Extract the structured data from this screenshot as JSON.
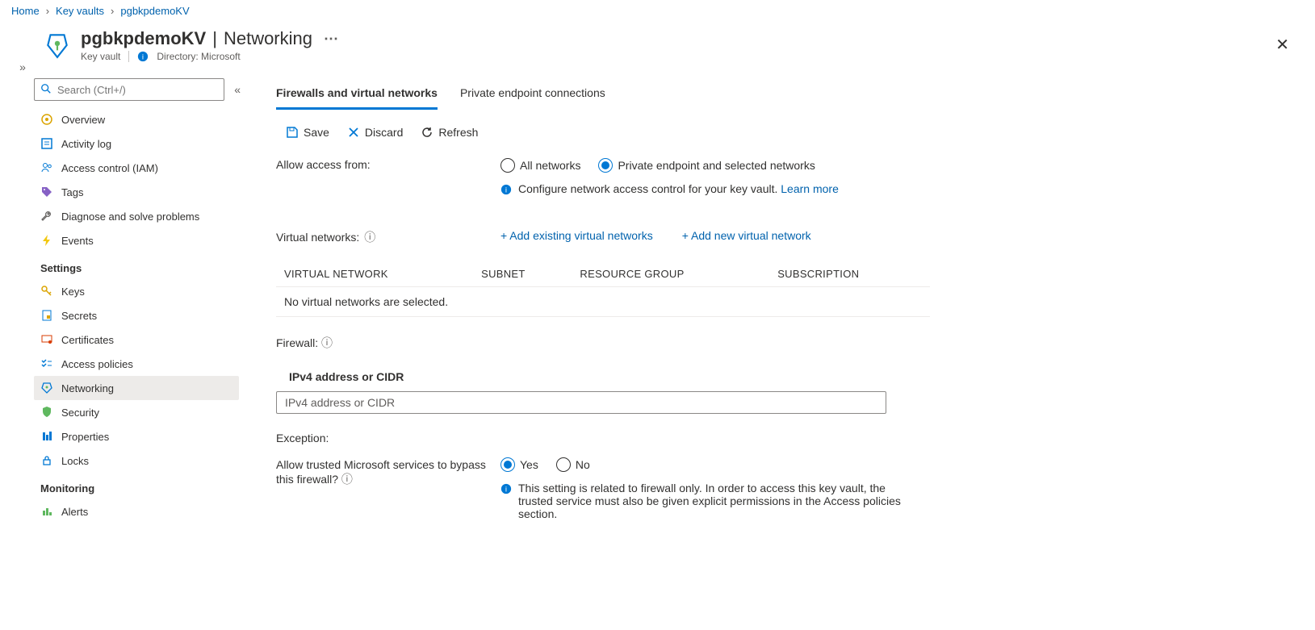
{
  "breadcrumb": {
    "home": "Home",
    "level1": "Key vaults",
    "level2": "pgbkpdemoKV"
  },
  "header": {
    "title": "pgbkpdemoKV",
    "section": "Networking",
    "subtitle": "Key vault",
    "directory": "Directory: Microsoft"
  },
  "search": {
    "placeholder": "Search (Ctrl+/)"
  },
  "nav": {
    "overview": "Overview",
    "activity": "Activity log",
    "iam": "Access control (IAM)",
    "tags": "Tags",
    "diag": "Diagnose and solve problems",
    "events": "Events",
    "settings_heading": "Settings",
    "keys": "Keys",
    "secrets": "Secrets",
    "certs": "Certificates",
    "access": "Access policies",
    "networking": "Networking",
    "security": "Security",
    "properties": "Properties",
    "locks": "Locks",
    "monitoring_heading": "Monitoring",
    "alerts": "Alerts"
  },
  "tabs": {
    "firewalls": "Firewalls and virtual networks",
    "pe": "Private endpoint connections"
  },
  "toolbar": {
    "save": "Save",
    "discard": "Discard",
    "refresh": "Refresh"
  },
  "allow": {
    "label": "Allow access from:",
    "all": "All networks",
    "selected": "Private endpoint and selected networks",
    "hint": "Configure network access control for your key vault.",
    "learn": "Learn more"
  },
  "vnet": {
    "label": "Virtual networks:",
    "add_existing": "+ Add existing virtual networks",
    "add_new": "+ Add new virtual network",
    "col_vnet": "Virtual Network",
    "col_subnet": "Subnet",
    "col_rg": "Resource Group",
    "col_sub": "Subscription",
    "empty": "No virtual networks are selected."
  },
  "firewall": {
    "label": "Firewall:",
    "cidr_heading": "IPv4 address or CIDR",
    "cidr_placeholder": "IPv4 address or CIDR"
  },
  "exception": {
    "heading": "Exception:",
    "question": "Allow trusted Microsoft services to bypass this firewall?",
    "yes": "Yes",
    "no": "No",
    "note": "This setting is related to firewall only. In order to access this key vault, the trusted service must also be given explicit permissions in the Access policies section."
  }
}
